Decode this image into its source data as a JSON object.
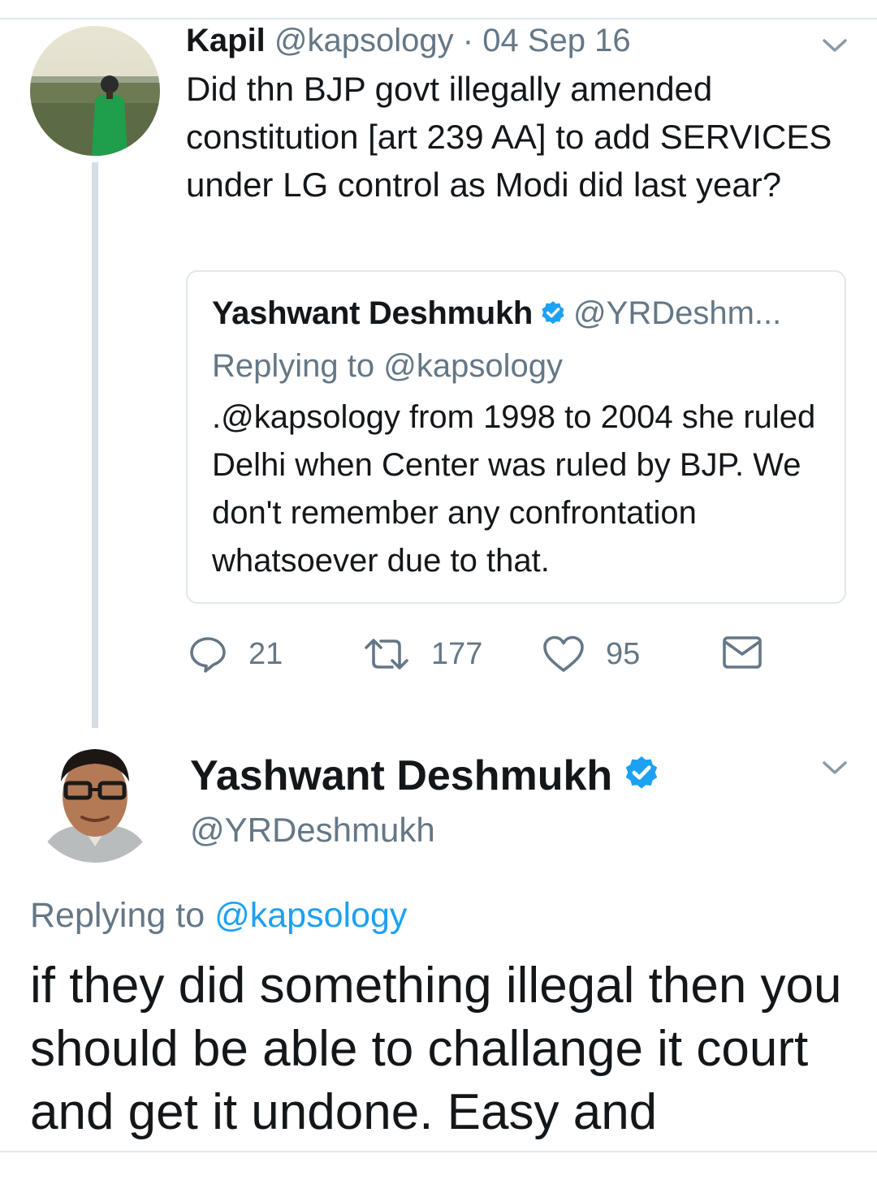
{
  "colors": {
    "text_primary": "#14171a",
    "text_secondary": "#657786",
    "link_blue": "#1da1f2",
    "divider": "#e1e8ed",
    "thread_line": "#d6dee5"
  },
  "parent_tweet": {
    "author_name": "Kapil",
    "author_handle": "@kapsology",
    "date": "· 04 Sep 16",
    "text": "Did thn BJP govt illegally amended constitution [art 239 AA] to add SERVICES under LG control as Modi did last year?",
    "avatar_icon": "profile-photo-person-in-field",
    "menu_icon": "chevron-down-icon",
    "quoted_tweet": {
      "author_name": "Yashwant Deshmukh",
      "verified_icon": "verified-badge-icon",
      "author_handle": "@YRDeshm...",
      "replying_to": "Replying to @kapsology",
      "text": ".@kapsology from 1998 to 2004 she ruled Delhi when Center was ruled by BJP. We don't remember any confrontation whatsoever due to that."
    },
    "actions": {
      "reply_count": "21",
      "retweet_count": "177",
      "like_count": "95",
      "icons": [
        "reply-icon",
        "retweet-icon",
        "like-heart-icon",
        "direct-message-icon"
      ]
    }
  },
  "main_tweet": {
    "author_name": "Yashwant Deshmukh",
    "author_handle": "@YRDeshmukh",
    "verified_icon": "verified-badge-icon",
    "avatar_icon": "profile-photo-man-with-glasses",
    "menu_icon": "chevron-down-icon",
    "replying_label": "Replying to",
    "replying_handle": "@kapsology",
    "text": "if they did something illegal then you should be able to challange it court and get it undone. Easy and"
  }
}
